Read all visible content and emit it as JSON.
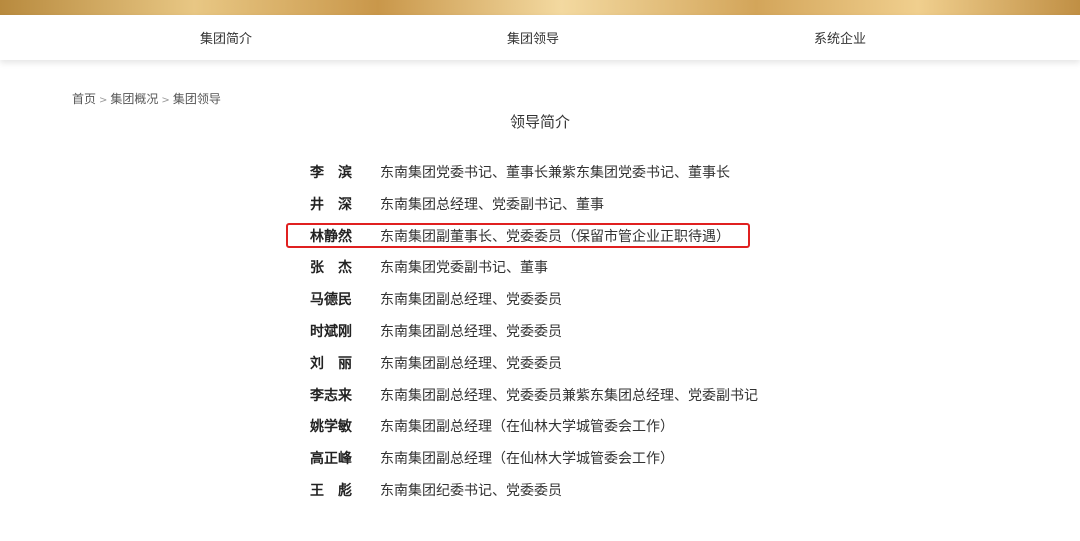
{
  "nav": {
    "items": [
      {
        "label": "集团简介"
      },
      {
        "label": "集团领导"
      },
      {
        "label": "系统企业"
      }
    ]
  },
  "breadcrumb": {
    "items": [
      "首页",
      "集团概况",
      "集团领导"
    ],
    "separator": ">"
  },
  "page": {
    "title": "领导简介"
  },
  "leaders": [
    {
      "name": "李　滨",
      "title": "东南集团党委书记、董事长兼紫东集团党委书记、董事长"
    },
    {
      "name": "井　深",
      "title": "东南集团总经理、党委副书记、董事"
    },
    {
      "name": "林静然",
      "title": "东南集团副董事长、党委委员（保留市管企业正职待遇）"
    },
    {
      "name": "张　杰",
      "title": "东南集团党委副书记、董事"
    },
    {
      "name": "马德民",
      "title": "东南集团副总经理、党委委员"
    },
    {
      "name": "时斌刚",
      "title": "东南集团副总经理、党委委员"
    },
    {
      "name": "刘　丽",
      "title": "东南集团副总经理、党委委员"
    },
    {
      "name": "李志来",
      "title": "东南集团副总经理、党委委员兼紫东集团总经理、党委副书记"
    },
    {
      "name": "姚学敏",
      "title": "东南集团副总经理（在仙林大学城管委会工作）"
    },
    {
      "name": "高正峰",
      "title": "东南集团副总经理（在仙林大学城管委会工作）"
    },
    {
      "name": "王　彪",
      "title": "东南集团纪委书记、党委委员"
    }
  ],
  "colors": {
    "highlight_border": "#e02020",
    "banner_gold": "#d3a55a"
  }
}
